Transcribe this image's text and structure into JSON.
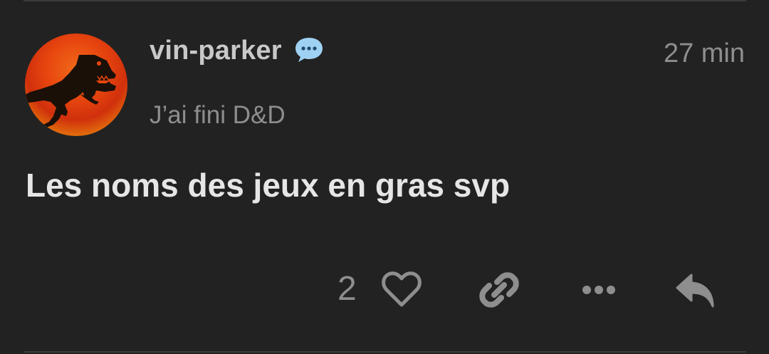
{
  "post": {
    "username": "vin-parker",
    "timestamp": "27 min",
    "user_title": "J’ai fini D&D",
    "body": "Les noms des jeux en gras svp",
    "like_count": "2"
  },
  "icons": {
    "status": "chat-bubble-icon",
    "like": "heart-icon",
    "link": "link-icon",
    "more": "more-icon",
    "reply": "reply-icon"
  },
  "colors": {
    "background": "#222222",
    "username": "#c8c8c8",
    "muted": "#8e8e8e",
    "body": "#e6e6e6",
    "chat_bubble": "#9fd1f2"
  }
}
